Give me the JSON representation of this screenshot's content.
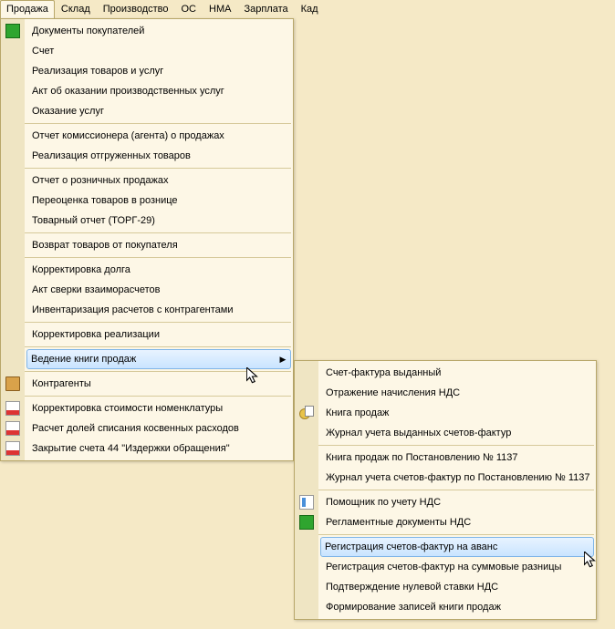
{
  "menubar": {
    "items": [
      "Продажа",
      "Склад",
      "Производство",
      "ОС",
      "НМА",
      "Зарплата",
      "Кад"
    ],
    "active_index": 0
  },
  "main_menu": {
    "groups": [
      {
        "items": [
          {
            "label": "Документы покупателей",
            "icon": "green"
          },
          {
            "label": "Счет"
          },
          {
            "label": "Реализация товаров и услуг"
          },
          {
            "label": "Акт об оказании производственных услуг"
          },
          {
            "label": "Оказание услуг"
          }
        ]
      },
      {
        "items": [
          {
            "label": "Отчет комиссионера (агента) о продажах"
          },
          {
            "label": "Реализация отгруженных товаров"
          }
        ]
      },
      {
        "items": [
          {
            "label": "Отчет о розничных продажах"
          },
          {
            "label": "Переоценка товаров в рознице"
          },
          {
            "label": "Товарный отчет (ТОРГ-29)"
          }
        ]
      },
      {
        "items": [
          {
            "label": "Возврат товаров от покупателя"
          }
        ]
      },
      {
        "items": [
          {
            "label": "Корректировка долга"
          },
          {
            "label": "Акт сверки взаиморасчетов"
          },
          {
            "label": "Инвентаризация расчетов с контрагентами"
          }
        ]
      },
      {
        "items": [
          {
            "label": "Корректировка реализации"
          }
        ]
      },
      {
        "items": [
          {
            "label": "Ведение книги продаж",
            "submenu": true,
            "highlight": true
          }
        ]
      },
      {
        "items": [
          {
            "label": "Контрагенты",
            "icon": "folder"
          }
        ]
      },
      {
        "items": [
          {
            "label": "Корректировка стоимости номенклатуры",
            "icon": "cal"
          },
          {
            "label": "Расчет долей списания косвенных расходов",
            "icon": "cal"
          },
          {
            "label": "Закрытие счета 44 \"Издержки обращения\"",
            "icon": "cal"
          }
        ]
      }
    ]
  },
  "sub_menu": {
    "groups": [
      {
        "items": [
          {
            "label": "Счет-фактура выданный"
          },
          {
            "label": "Отражение начисления НДС"
          },
          {
            "label": "Книга продаж",
            "icon": "coin"
          },
          {
            "label": "Журнал учета выданных счетов-фактур"
          }
        ]
      },
      {
        "items": [
          {
            "label": "Книга продаж по Постановлению № 1137"
          },
          {
            "label": "Журнал учета счетов-фактур по Постановлению № 1137"
          }
        ]
      },
      {
        "items": [
          {
            "label": "Помощник по учету НДС",
            "icon": "wiz"
          },
          {
            "label": "Регламентные документы НДС",
            "icon": "green"
          }
        ]
      },
      {
        "items": [
          {
            "label": "Регистрация счетов-фактур на аванс",
            "highlight": true
          },
          {
            "label": "Регистрация счетов-фактур на суммовые разницы"
          },
          {
            "label": "Подтверждение нулевой ставки НДС"
          },
          {
            "label": "Формирование записей книги продаж"
          }
        ]
      }
    ]
  }
}
